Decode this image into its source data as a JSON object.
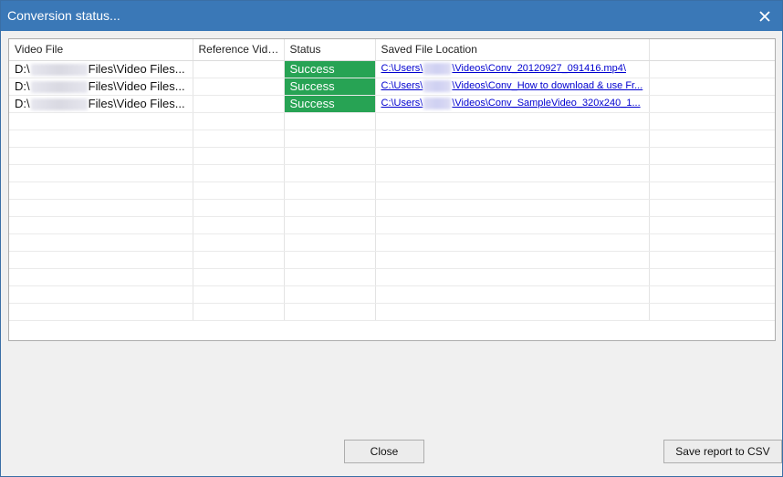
{
  "window": {
    "title": "Conversion status..."
  },
  "grid": {
    "columns": [
      "Video File",
      "Reference Video...",
      "Status",
      "Saved File Location",
      ""
    ],
    "rows": [
      {
        "file_prefix": "D:\\",
        "file_suffix": "Files\\Video Files...",
        "reference": "",
        "status": "Success",
        "loc_prefix": "C:\\Users\\",
        "loc_suffix": "\\Videos\\Conv_20120927_091416.mp4\\"
      },
      {
        "file_prefix": "D:\\",
        "file_suffix": "Files\\Video Files...",
        "reference": "",
        "status": "Success",
        "loc_prefix": "C:\\Users\\",
        "loc_suffix": "\\Videos\\Conv_How to download & use Fr..."
      },
      {
        "file_prefix": "D:\\",
        "file_suffix": "Files\\Video Files...",
        "reference": "",
        "status": "Success",
        "loc_prefix": "C:\\Users\\",
        "loc_suffix": "\\Videos\\Conv_SampleVideo_320x240_1..."
      }
    ],
    "empty_row_count": 12
  },
  "buttons": {
    "close_label": "Close",
    "save_csv_label": "Save report to CSV"
  },
  "colors": {
    "titlebar": "#3a78b7",
    "success": "#27a354",
    "link": "#0000d0"
  },
  "icons": {
    "close": "close-icon"
  }
}
